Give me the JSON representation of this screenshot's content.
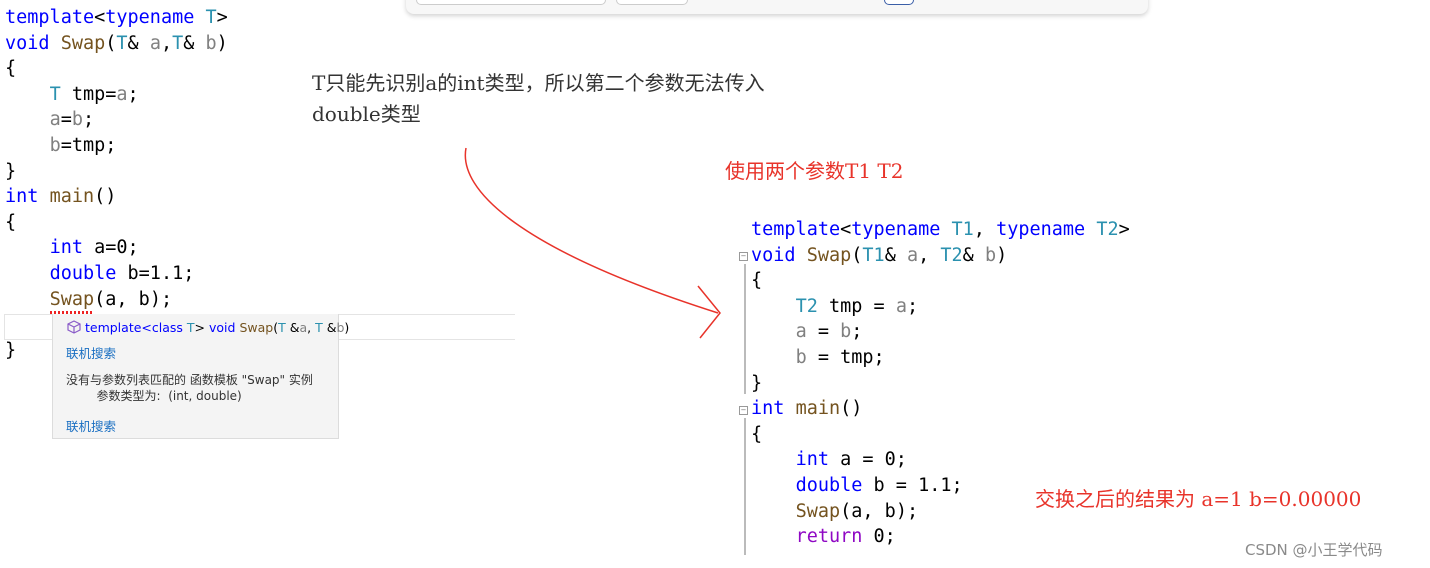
{
  "colors": {
    "keyword": "#0000ff",
    "type": "#2b91af",
    "function": "#74531f",
    "param": "#808080",
    "return": "#8f08c4",
    "annotation": "#e8332a",
    "link": "#1a6fc2"
  },
  "left_code": {
    "lines": [
      [
        [
          "template",
          "kw"
        ],
        [
          "<",
          "pl"
        ],
        [
          "typename",
          "kw"
        ],
        [
          " ",
          "pl"
        ],
        [
          "T",
          "ty"
        ],
        [
          ">",
          "pl"
        ]
      ],
      [
        [
          "void",
          "kw"
        ],
        [
          " ",
          "pl"
        ],
        [
          "Swap",
          "fn"
        ],
        [
          "(",
          "pl"
        ],
        [
          "T",
          "ty"
        ],
        [
          "& ",
          "pl"
        ],
        [
          "a",
          "pm"
        ],
        [
          ",",
          "pl"
        ],
        [
          "T",
          "ty"
        ],
        [
          "& ",
          "pl"
        ],
        [
          "b",
          "pm"
        ],
        [
          ")",
          "pl"
        ]
      ],
      [
        [
          "{",
          "pl"
        ]
      ],
      [
        [
          "    ",
          "pl"
        ],
        [
          "T",
          "ty"
        ],
        [
          " tmp=",
          "pl"
        ],
        [
          "a",
          "pm"
        ],
        [
          ";",
          "pl"
        ]
      ],
      [
        [
          "    ",
          "pl"
        ],
        [
          "a",
          "pm"
        ],
        [
          "=",
          "pl"
        ],
        [
          "b",
          "pm"
        ],
        [
          ";",
          "pl"
        ]
      ],
      [
        [
          "    ",
          "pl"
        ],
        [
          "b",
          "pm"
        ],
        [
          "=tmp;",
          "pl"
        ]
      ],
      [
        [
          "}",
          "pl"
        ]
      ],
      [
        [
          "int",
          "kw"
        ],
        [
          " ",
          "pl"
        ],
        [
          "main",
          "fn"
        ],
        [
          "()",
          "pl"
        ]
      ],
      [
        [
          "{",
          "pl"
        ]
      ],
      [
        [
          "    ",
          "pl"
        ],
        [
          "int",
          "kw"
        ],
        [
          " a=0;",
          "pl"
        ]
      ],
      [
        [
          "    ",
          "pl"
        ],
        [
          "double",
          "kw"
        ],
        [
          " b=1.1;",
          "pl"
        ]
      ],
      [
        [
          "    ",
          "pl"
        ],
        [
          "Swap",
          "fn"
        ],
        [
          "(a, b);",
          "pl"
        ]
      ],
      [
        [
          "",
          "pl"
        ]
      ],
      [
        [
          "}",
          "pl"
        ]
      ]
    ]
  },
  "tooltip": {
    "icon": "template-cube-icon",
    "signature": [
      [
        "template",
        "kw"
      ],
      [
        "<class ",
        "kw"
      ],
      [
        "T",
        "ty"
      ],
      [
        "> ",
        "pl"
      ],
      [
        "void ",
        "kw"
      ],
      [
        "Swap",
        "fn"
      ],
      [
        "(",
        "pl"
      ],
      [
        "T",
        "ty"
      ],
      [
        " &",
        "pl"
      ],
      [
        "a",
        "pm"
      ],
      [
        ", ",
        "pl"
      ],
      [
        "T",
        "ty"
      ],
      [
        " &",
        "pl"
      ],
      [
        "b",
        "pm"
      ],
      [
        ")",
        "pl"
      ]
    ],
    "link1": "联机搜索",
    "message": "没有与参数列表匹配的 函数模板 \"Swap\" 实例\n        参数类型为:  (int, double)",
    "link2": "联机搜索"
  },
  "notes": {
    "note1_line1": "T只能先识别a的int类型，所以第二个参数无法传入",
    "note1_line2": "double类型",
    "note2": "使用两个参数T1 T2",
    "note3": "交换之后的结果为  a=1 b=0.00000"
  },
  "right_code": {
    "lines": [
      [
        [
          "template",
          "kw"
        ],
        [
          "<",
          "pl"
        ],
        [
          "typename",
          "kw"
        ],
        [
          " ",
          "pl"
        ],
        [
          "T1",
          "ty"
        ],
        [
          ", ",
          "pl"
        ],
        [
          "typename",
          "kw"
        ],
        [
          " ",
          "pl"
        ],
        [
          "T2",
          "ty"
        ],
        [
          ">",
          "pl"
        ]
      ],
      [
        [
          "void",
          "kw"
        ],
        [
          " ",
          "pl"
        ],
        [
          "Swap",
          "fn"
        ],
        [
          "(",
          "pl"
        ],
        [
          "T1",
          "ty"
        ],
        [
          "& ",
          "pl"
        ],
        [
          "a",
          "pm"
        ],
        [
          ", ",
          "pl"
        ],
        [
          "T2",
          "ty"
        ],
        [
          "& ",
          "pl"
        ],
        [
          "b",
          "pm"
        ],
        [
          ")",
          "pl"
        ]
      ],
      [
        [
          "{",
          "pl"
        ]
      ],
      [
        [
          "    ",
          "pl"
        ],
        [
          "T2",
          "ty"
        ],
        [
          " tmp = ",
          "pl"
        ],
        [
          "a",
          "pm"
        ],
        [
          ";",
          "pl"
        ]
      ],
      [
        [
          "    ",
          "pl"
        ],
        [
          "a",
          "pm"
        ],
        [
          " = ",
          "pl"
        ],
        [
          "b",
          "pm"
        ],
        [
          ";",
          "pl"
        ]
      ],
      [
        [
          "    ",
          "pl"
        ],
        [
          "b",
          "pm"
        ],
        [
          " = tmp;",
          "pl"
        ]
      ],
      [
        [
          "}",
          "pl"
        ]
      ],
      [
        [
          "int",
          "kw"
        ],
        [
          " ",
          "pl"
        ],
        [
          "main",
          "fn"
        ],
        [
          "()",
          "pl"
        ]
      ],
      [
        [
          "{",
          "pl"
        ]
      ],
      [
        [
          "    ",
          "pl"
        ],
        [
          "int",
          "kw"
        ],
        [
          " a = 0;",
          "pl"
        ]
      ],
      [
        [
          "    ",
          "pl"
        ],
        [
          "double",
          "kw"
        ],
        [
          " b = 1.1;",
          "pl"
        ]
      ],
      [
        [
          "    ",
          "pl"
        ],
        [
          "Swap",
          "fn"
        ],
        [
          "(a, b);",
          "pl"
        ]
      ],
      [
        [
          "    ",
          "pl"
        ],
        [
          "return",
          "rt"
        ],
        [
          " 0;",
          "pl"
        ]
      ]
    ]
  },
  "watermark": "CSDN @小王学代码"
}
